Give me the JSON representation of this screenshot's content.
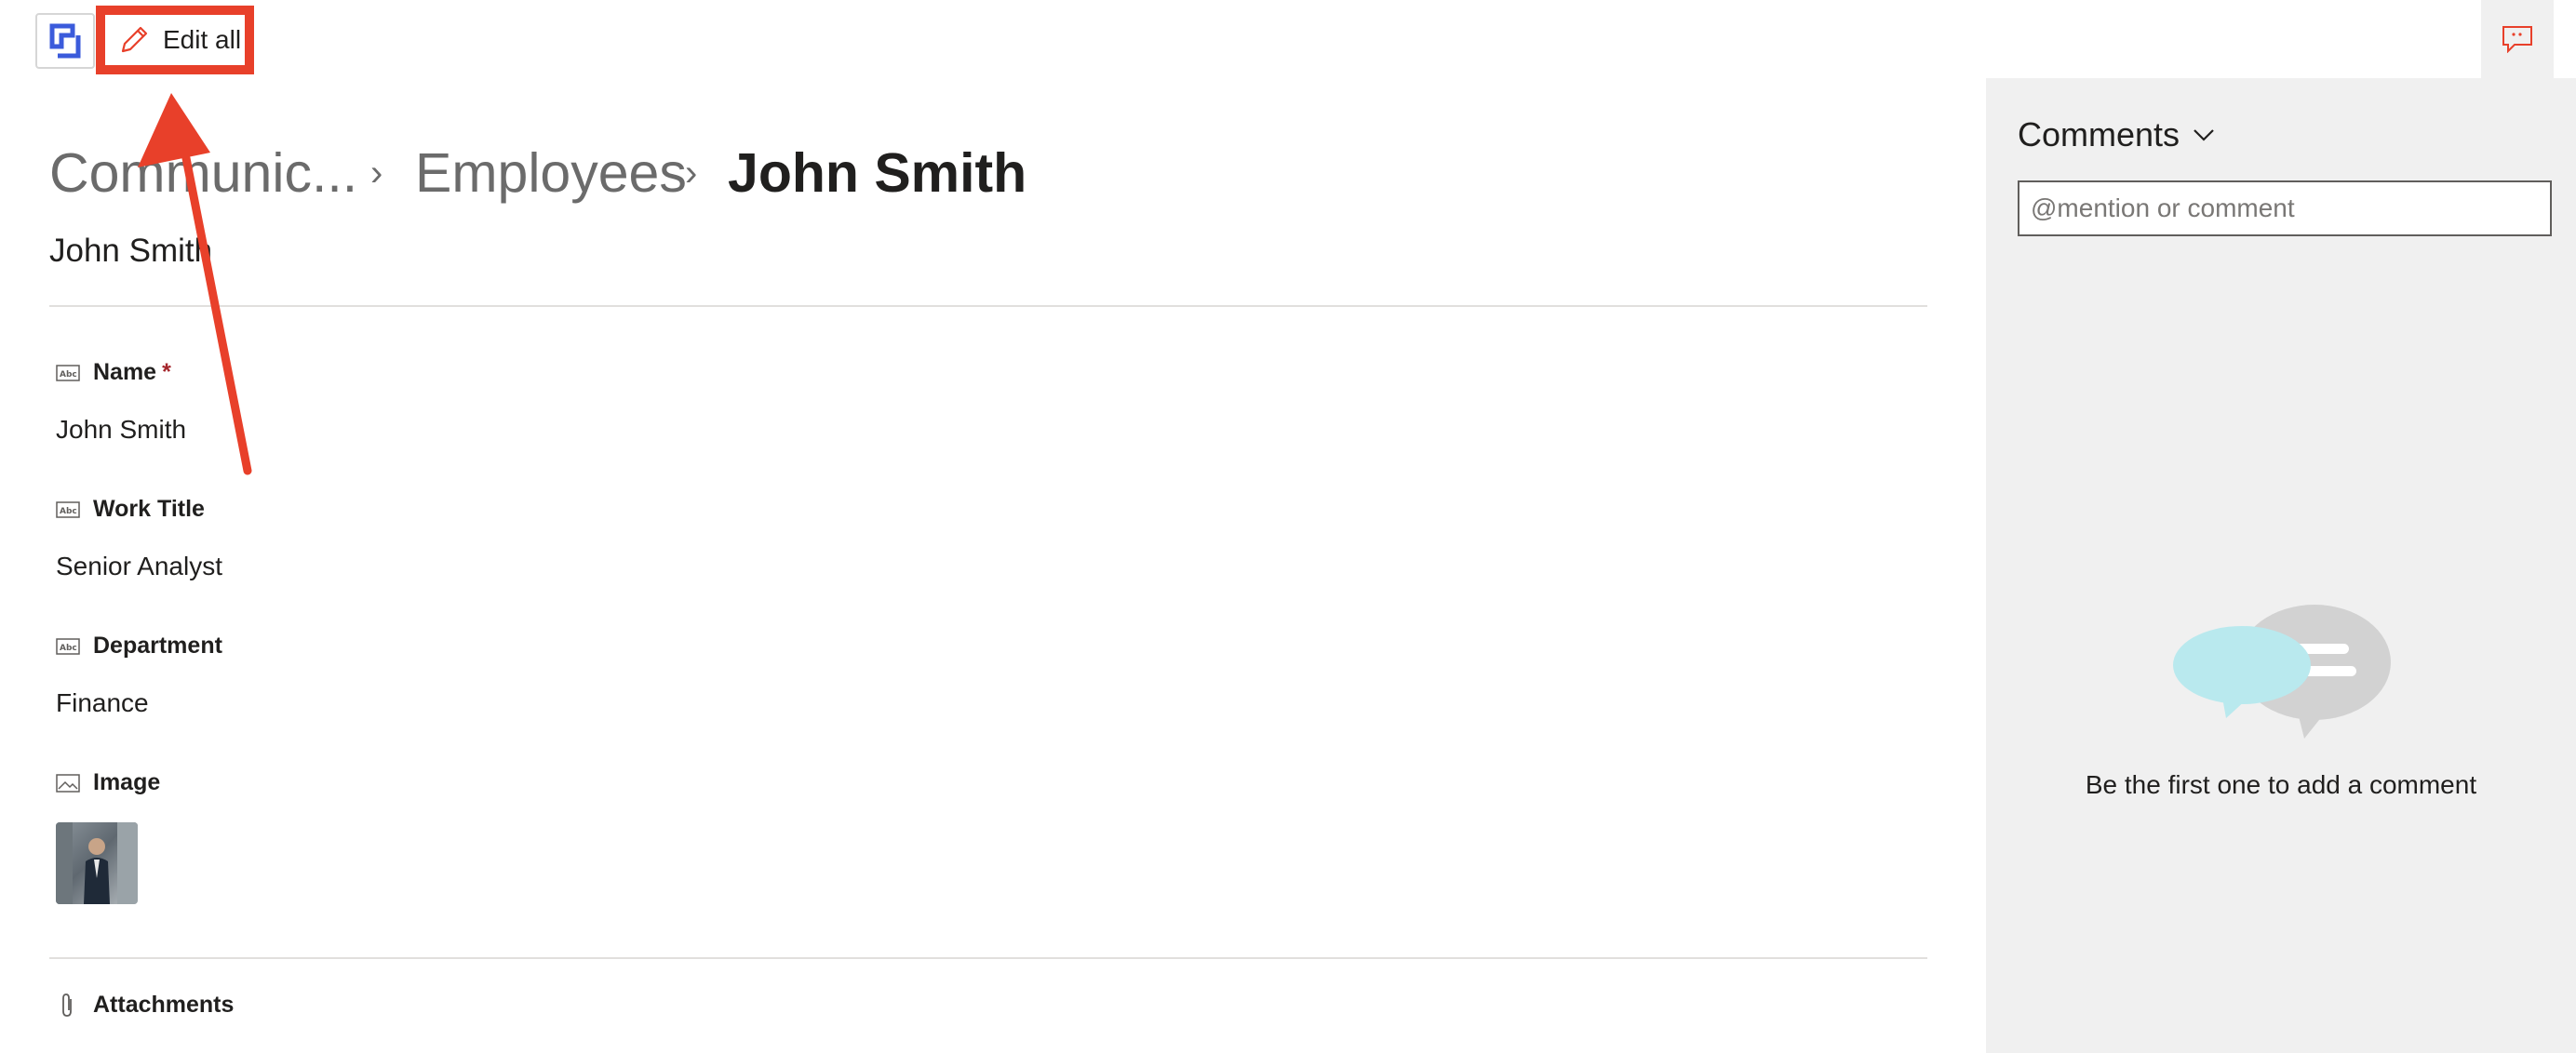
{
  "toolbar": {
    "logo_icon": "app-logo-icon",
    "edit_all_label": "Edit all",
    "edit_icon": "pencil-icon",
    "comments_toggle_icon": "comment-icon"
  },
  "breadcrumb": {
    "items": [
      "Communic...",
      "Employees",
      "John Smith"
    ],
    "separator_icon": "chevron-right-icon"
  },
  "item": {
    "title": "John Smith",
    "fields": [
      {
        "label": "Name",
        "required_mark": "*",
        "value": "John Smith",
        "icon": "text-field-icon"
      },
      {
        "label": "Work Title",
        "value": "Senior Analyst",
        "icon": "text-field-icon"
      },
      {
        "label": "Department",
        "value": "Finance",
        "icon": "text-field-icon"
      },
      {
        "label": "Image",
        "icon": "image-field-icon"
      }
    ],
    "attachments_label": "Attachments",
    "attachments_icon": "paperclip-icon"
  },
  "comments": {
    "title": "Comments",
    "placeholder": "@mention or comment",
    "empty_message": "Be the first one to add a comment"
  },
  "colors": {
    "accent": "#e8402a",
    "pane_bg": "#f0f0f0",
    "logo_blue": "#3b5bdb"
  }
}
